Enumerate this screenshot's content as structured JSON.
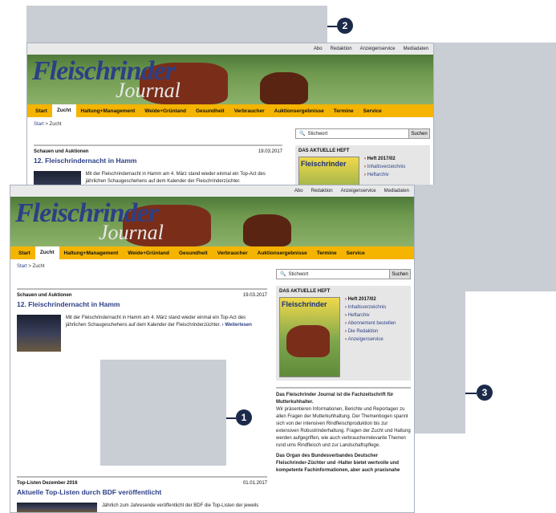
{
  "callouts": [
    "1",
    "2",
    "3"
  ],
  "site": {
    "topbar": [
      "Abo",
      "Redaktion",
      "Anzeigenservice",
      "Mediadaten"
    ],
    "logo_line1": "Fleischrinder",
    "logo_line2": "Journal",
    "nav": [
      "Start",
      "Zucht",
      "Haltung+Management",
      "Weide+Grünland",
      "Gesundheit",
      "Verbraucher",
      "Auktionsergebnisse",
      "Termine",
      "Service"
    ],
    "nav_active": "Zucht",
    "breadcrumb_start": "Start",
    "breadcrumb_sep": ">",
    "breadcrumb_current": "Zucht",
    "article1": {
      "kicker": "Schauen und Auktionen",
      "date": "19.03.2017",
      "title": "12. Fleischrindernacht in Hamm",
      "text": "Mit der Fleischrindernacht in Hamm am 4. März stand wieder einmal ein Top-Act des jährlichen Schaugeschehens auf dem Kalender der Fleischrinderzüchter.",
      "more": "Weiterlesen"
    },
    "article2": {
      "kicker": "Top-Listen Dezember 2016",
      "date": "01.01.2017",
      "title": "Aktuelle Top-Listen durch BDF veröffentlicht",
      "text": "Jährlich zum Jahresende veröffentlicht der BDF die Top-Listen der jeweils"
    },
    "search_placeholder": "Stichwort",
    "search_button": "Suchen",
    "heft_title": "DAS AKTUELLE HEFT",
    "heft_issue": "Heft 2017/02",
    "cover_title": "Fleischrinder",
    "heft_links": [
      "Inhaltsverzeichnis",
      "Heftarchiv",
      "Abonnement bestellen",
      "Die Redaktion",
      "Anzeigenservice"
    ],
    "about_bold": "Das Fleischrinder Journal ist die Fachzeitschrift für Mutterkuhhalter.",
    "about_text": "Wir präsentieren Informationen, Berichte und Reportagen zu allen Fragen der Mutterkuhhaltung. Der Themenbogen spannt sich von der intensiven Rindfleischproduktion bis zur extensiven Robustrinderhaltung. Fragen der Zucht und Haltung werden aufgegriffen, wie auch verbraucherrelevante Themen rund ums Rindfleisch und zur Landschaftspflege.",
    "about_bold2": "Das Organ des Bundesverbandes Deutscher Fleischrinder-Züchter und -Halter bietet wertvolle und kompetente Fachinformationen, aber auch praxisnahe"
  }
}
